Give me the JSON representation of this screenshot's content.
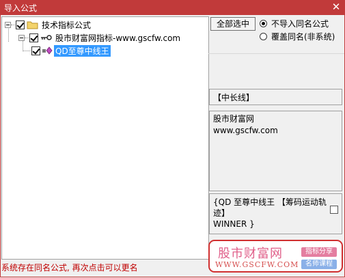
{
  "window": {
    "title": "导入公式",
    "close_glyph": "✕"
  },
  "tree": {
    "nodes": [
      {
        "label": "技术指标公式",
        "checked": true,
        "icon": "folder-icon"
      },
      {
        "label": "股市财富网指标-www.gscfw.com",
        "checked": true,
        "icon": "key-icon"
      },
      {
        "label": "QD至尊中线王",
        "checked": true,
        "icon": "formula-icon",
        "selected": true
      }
    ]
  },
  "options": {
    "select_all_label": "全部选中",
    "radio_no_import": "不导入同名公式",
    "radio_overwrite": "覆盖同名(非系统)",
    "selected_radio": "no_import"
  },
  "details": {
    "category": "【中长线】",
    "desc_line1": "股市财富网",
    "desc_line2": "www.gscfw.com",
    "code_line1": "{QD 至尊中线王 【筹码运动轨",
    "code_line2": "迹】",
    "code_line3": "WINNER }"
  },
  "status": "系统存在同名公式, 再次点击可以更名",
  "watermark": {
    "name": "股市财富网",
    "url": "WWW.GSCFW.COM",
    "tag1": "指标分享",
    "tag2": "名师课程"
  },
  "colors": {
    "titlebar": "#c13a3a",
    "selection": "#3399ff",
    "status_text": "#c00000"
  }
}
